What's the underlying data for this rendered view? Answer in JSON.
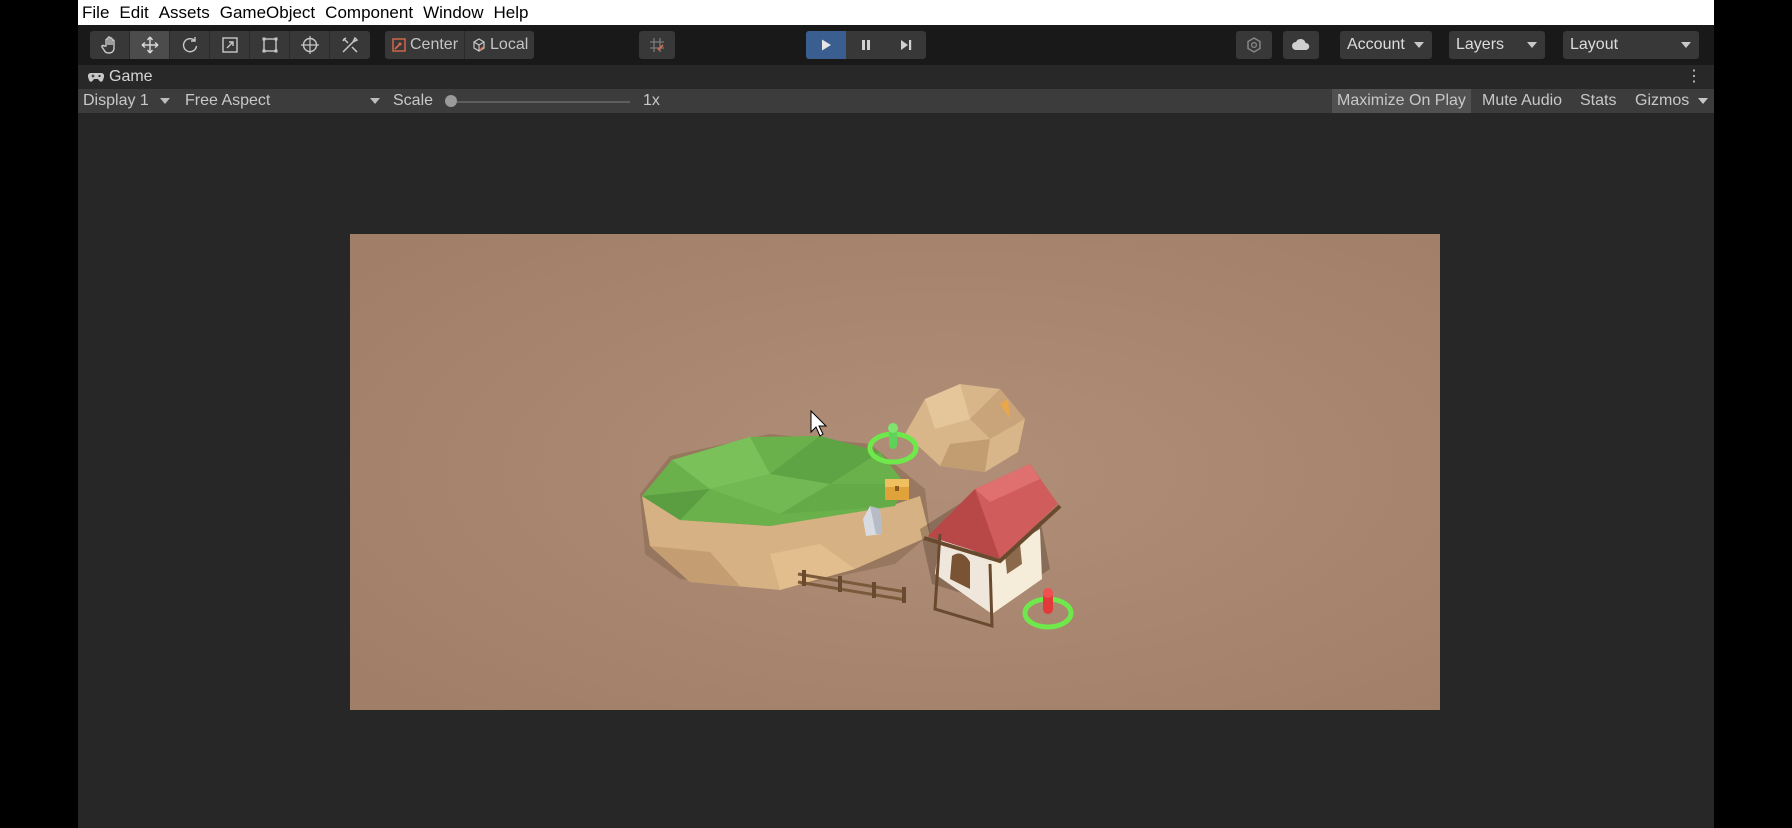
{
  "menu": [
    "File",
    "Edit",
    "Assets",
    "GameObject",
    "Component",
    "Window",
    "Help"
  ],
  "toolbar": {
    "tools": [
      {
        "name": "hand-tool-icon",
        "active": false
      },
      {
        "name": "move-tool-icon",
        "active": true
      },
      {
        "name": "rotate-tool-icon",
        "active": false
      },
      {
        "name": "scale-tool-icon",
        "active": false
      },
      {
        "name": "rect-tool-icon",
        "active": false
      },
      {
        "name": "transform-tool-icon",
        "active": false
      },
      {
        "name": "custom-tool-icon",
        "active": false
      }
    ],
    "pivot_label": "Center",
    "space_label": "Local",
    "account_label": "Account",
    "layers_label": "Layers",
    "layout_label": "Layout",
    "play_state": "playing"
  },
  "game_tab": {
    "title": "Game",
    "display": "Display 1",
    "aspect": "Free Aspect",
    "scale_label": "Scale",
    "scale_value": "1x",
    "maximize_label": "Maximize On Play",
    "mute_label": "Mute Audio",
    "stats_label": "Stats",
    "gizmos_label": "Gizmos",
    "maximize_on": true
  },
  "scene": {
    "background_color": "#a98770",
    "ground_color": "#6eb84f",
    "roof_color": "#c85a5a",
    "marker_ring_color": "#6ee84a",
    "player_color": "#5fd25a",
    "enemy_color": "#e23a3a"
  }
}
